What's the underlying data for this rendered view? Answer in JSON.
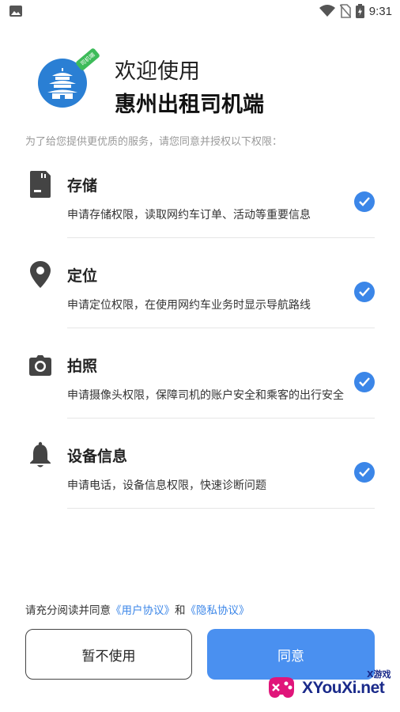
{
  "status_bar": {
    "time": "9:31",
    "icons": [
      "gallery-icon",
      "wifi-icon",
      "no-sim-icon",
      "battery-icon"
    ]
  },
  "header": {
    "app_icon": "app-icon",
    "badge_text": "司机端",
    "welcome": "欢迎使用",
    "app_name": "惠州出租司机端"
  },
  "intro": "为了给您提供更优质的服务，请您同意并授权以下权限：",
  "permissions": [
    {
      "icon": "storage-icon",
      "title": "存储",
      "description": "申请存储权限，读取网约车订单、活动等重要信息",
      "checked": true
    },
    {
      "icon": "location-icon",
      "title": "定位",
      "description": "申请定位权限，在使用网约车业务时显示导航路线",
      "checked": true
    },
    {
      "icon": "camera-icon",
      "title": "拍照",
      "description": "申请摄像头权限，保障司机的账户安全和乘客的出行安全",
      "checked": true
    },
    {
      "icon": "bell-icon",
      "title": "设备信息",
      "description": "申请电话，设备信息权限，快速诊断问题",
      "checked": true
    }
  ],
  "agreement": {
    "prefix": "请充分阅读并同意",
    "user_agreement": "《用户协议》",
    "and": "和",
    "privacy_agreement": "《隐私协议》"
  },
  "buttons": {
    "decline": "暂不使用",
    "agree": "同意"
  },
  "watermark": {
    "site": "XYouXi.net",
    "tag": "X游戏"
  },
  "colors": {
    "accent": "#3b86e8",
    "agree_button": "#4a90f0",
    "app_icon": "#2a7fd4",
    "badge": "#3dbb59"
  }
}
